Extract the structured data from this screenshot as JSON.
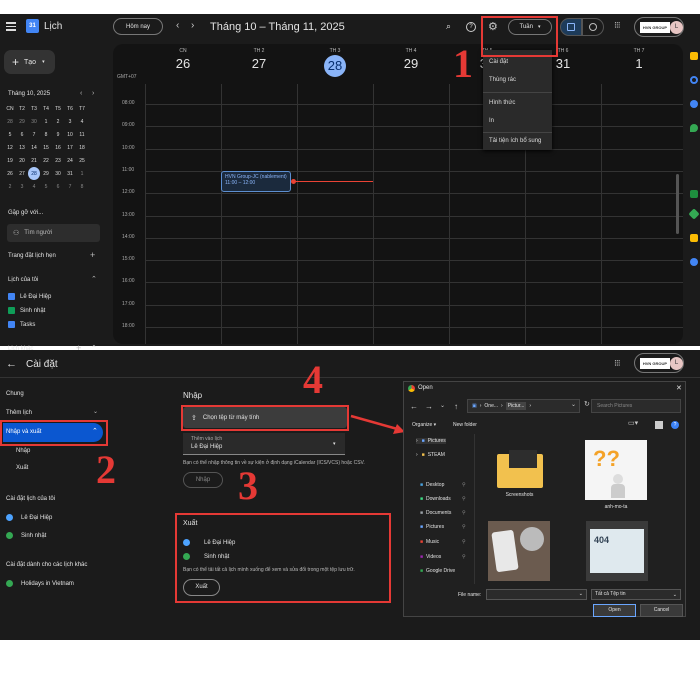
{
  "header": {
    "app_title": "Lịch",
    "today_button": "Hôm nay",
    "date_range": "Tháng 10 – Tháng 11, 2025",
    "view_selector": "Tuần",
    "brand": "HVN GROUP",
    "avatar_letter": "L"
  },
  "sidebar": {
    "create_button": "Tạo",
    "mini_month": "Tháng 10, 2025",
    "weekdays": [
      "CN",
      "T2",
      "T3",
      "T4",
      "T5",
      "T6",
      "T7"
    ],
    "weeks": [
      [
        "28",
        "29",
        "30",
        "1",
        "2",
        "3",
        "4"
      ],
      [
        "5",
        "6",
        "7",
        "8",
        "9",
        "10",
        "11"
      ],
      [
        "12",
        "13",
        "14",
        "15",
        "16",
        "17",
        "18"
      ],
      [
        "19",
        "20",
        "21",
        "22",
        "23",
        "24",
        "25"
      ],
      [
        "26",
        "27",
        "28",
        "29",
        "30",
        "31",
        "1"
      ],
      [
        "2",
        "3",
        "4",
        "5",
        "6",
        "7",
        "8"
      ]
    ],
    "meet_with": "Gặp gỡ với...",
    "search_people": "Tìm người",
    "booking_pages": "Trang đặt lịch hẹn",
    "my_calendars": "Lịch của tôi",
    "my_calendar_items": [
      {
        "label": "Lê Đại Hiệp",
        "color": "#4285f4"
      },
      {
        "label": "Sinh nhật",
        "color": "#0f9d58"
      },
      {
        "label": "Tasks",
        "color": "#4285f4"
      }
    ],
    "other_calendars": "Lịch khác"
  },
  "week": {
    "timezone": "GMT+07",
    "days": [
      {
        "name": "CN",
        "num": "26"
      },
      {
        "name": "TH 2",
        "num": "27"
      },
      {
        "name": "TH 3",
        "num": "28"
      },
      {
        "name": "TH 4",
        "num": "29"
      },
      {
        "name": "TH 5",
        "num": "30"
      },
      {
        "name": "TH 6",
        "num": "31"
      },
      {
        "name": "TH 7",
        "num": "1"
      }
    ],
    "hours": [
      "08:00",
      "09:00",
      "10:00",
      "11:00",
      "12:00",
      "13:00",
      "14:00",
      "15:00",
      "16:00",
      "17:00",
      "18:00"
    ],
    "event": {
      "title": "HVN Group-JC (nablement)",
      "time": "11:00 – 12:00"
    }
  },
  "settings_menu": {
    "items": [
      "Cài đặt",
      "Thùng rác",
      "Hình thức",
      "In",
      "Tải tiện ích bổ sung"
    ]
  },
  "settings": {
    "title": "Cài đặt",
    "nav": {
      "general": "Chung",
      "add_calendar": "Thêm lịch",
      "import_export": "Nhập và xuất",
      "import": "Nhập",
      "export": "Xuất",
      "my_cal_settings": "Cài đặt lịch của tôi",
      "my_cal_items": [
        {
          "label": "Lê Đại Hiệp",
          "color": "#4da3ff"
        },
        {
          "label": "Sinh nhật",
          "color": "#34a853"
        }
      ],
      "other_cal_settings": "Cài đặt dành cho các lịch khác",
      "other_cal_items": [
        {
          "label": "Holidays in Vietnam",
          "color": "#34a853"
        }
      ]
    },
    "import": {
      "heading": "Nhập",
      "choose_file": "Chọn tệp từ máy tính",
      "add_to_label": "Thêm vào lịch",
      "add_to_value": "Lê Đại Hiệp",
      "help": "Bạn có thể nhập thông tin về sự kiện ở định dạng iCalendar (ICS/VCS) hoặc CSV.",
      "import_button": "Nhập"
    },
    "export": {
      "heading": "Xuất",
      "items": [
        {
          "label": "Lê Đại Hiệp",
          "color": "#4da3ff"
        },
        {
          "label": "Sinh nhật",
          "color": "#34a853"
        }
      ],
      "help": "Bạn có thể tải tất cả lịch mình xuống để xem và sửa đổi trong một tệp lưu trữ.",
      "export_button": "Xuất"
    }
  },
  "dialog": {
    "title": "Open",
    "path": [
      "One...",
      "Pictur...",
      ""
    ],
    "search_placeholder": "Search Pictures",
    "organize": "Organize",
    "new_folder": "New folder",
    "tree": [
      {
        "label": "Pictures",
        "icon": "pictures-icon"
      },
      {
        "label": "STEAM",
        "icon": "folder-icon"
      },
      {
        "label": "Desktop",
        "icon": "desktop-icon"
      },
      {
        "label": "Downloads",
        "icon": "downloads-icon"
      },
      {
        "label": "Documents",
        "icon": "documents-icon"
      },
      {
        "label": "Pictures",
        "icon": "pictures-icon"
      },
      {
        "label": "Music",
        "icon": "music-icon"
      },
      {
        "label": "Videos",
        "icon": "videos-icon"
      },
      {
        "label": "Google Drive",
        "icon": "drive-icon"
      }
    ],
    "files": [
      {
        "label": "Screenshots"
      },
      {
        "label": "anh-mo-ta"
      },
      {
        "label": ""
      },
      {
        "label": ""
      }
    ],
    "file_name_label": "File name:",
    "file_type": "Tất cả Tệp tin",
    "open_button": "Open",
    "cancel_button": "Cancel"
  },
  "annotations": [
    "1",
    "2",
    "3",
    "4"
  ]
}
